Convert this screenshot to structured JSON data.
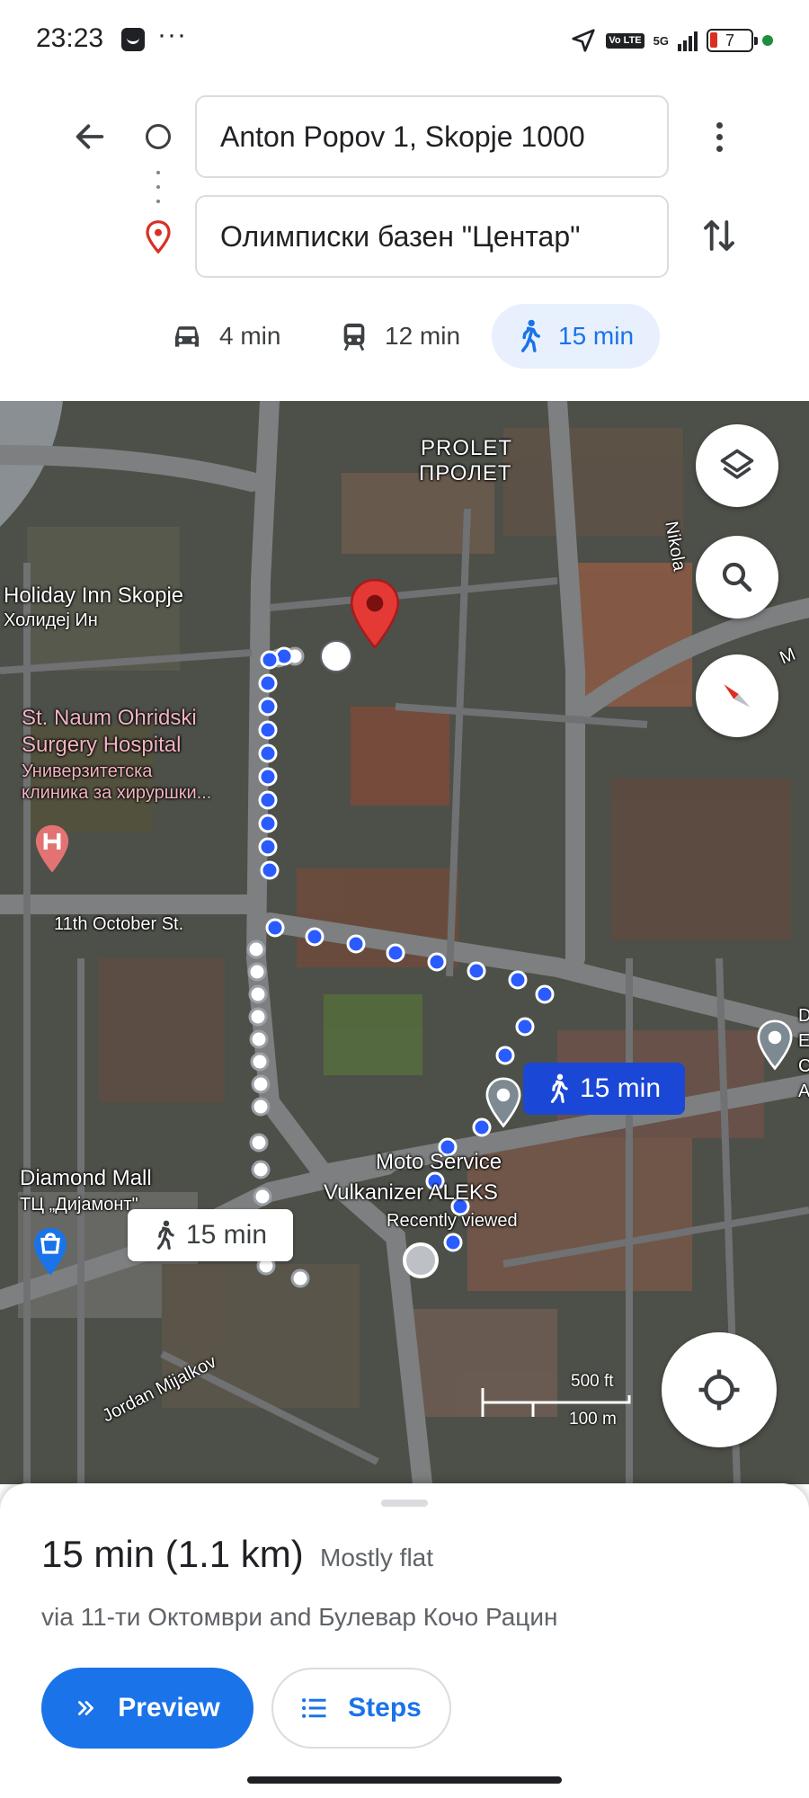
{
  "status_bar": {
    "time": "23:23",
    "more": "···",
    "vo_lte": "Vo LTE",
    "network": "5G",
    "battery_level": "7"
  },
  "directions": {
    "origin": "Anton Popov 1, Skopje 1000",
    "destination": "Олимписки базен \"Центар\""
  },
  "travel_modes": [
    {
      "mode": "driving",
      "icon": "car-icon",
      "duration": "4 min"
    },
    {
      "mode": "transit",
      "icon": "train-icon",
      "duration": "12 min"
    },
    {
      "mode": "walking",
      "icon": "walk-icon",
      "duration": "15 min",
      "selected": true
    }
  ],
  "map": {
    "labels": {
      "prolet_latin": "PROLET",
      "prolet_cyrillic": "ПРОЛЕТ",
      "nikola": "Nikola",
      "holiday_inn": "Holiday Inn Skopje",
      "holiday_inn_cyr": "Холидеј Ин",
      "hospital_1": "St. Naum Ohridski",
      "hospital_2": "Surgery Hospital",
      "hospital_3": "Универзитетска",
      "hospital_4": "клиника за хируршки...",
      "street_11_october": "11th October St.",
      "diamond_mall": "Diamond Mall",
      "diamond_mall_cyr": "ТЦ „Дијамонт\"",
      "moto_service_1": "Moto Service",
      "moto_service_2": "Vulkanizer ALEKS",
      "recently_viewed": "Recently viewed",
      "jordan_mijalkov": "Jordan Mijalkov",
      "right_edge_d": "D",
      "right_edge_e": "E",
      "right_edge_c": "C",
      "right_edge_a": "A",
      "right_edge_m": "M"
    },
    "route_chip_selected": "15 min",
    "route_chip_alt": "15 min",
    "scale_imperial": "500 ft",
    "scale_metric": "100 m",
    "colors": {
      "route_blue": "#1a47d6",
      "route_dot": "#2a5bff",
      "accent": "#1a73e8",
      "pin_red": "#d93025"
    }
  },
  "summary": {
    "duration_distance": "15 min (1.1 km)",
    "terrain": "Mostly flat",
    "via": "via 11-ти Октомври and Булевар Кочо Рацин"
  },
  "actions": {
    "preview": "Preview",
    "steps": "Steps"
  }
}
